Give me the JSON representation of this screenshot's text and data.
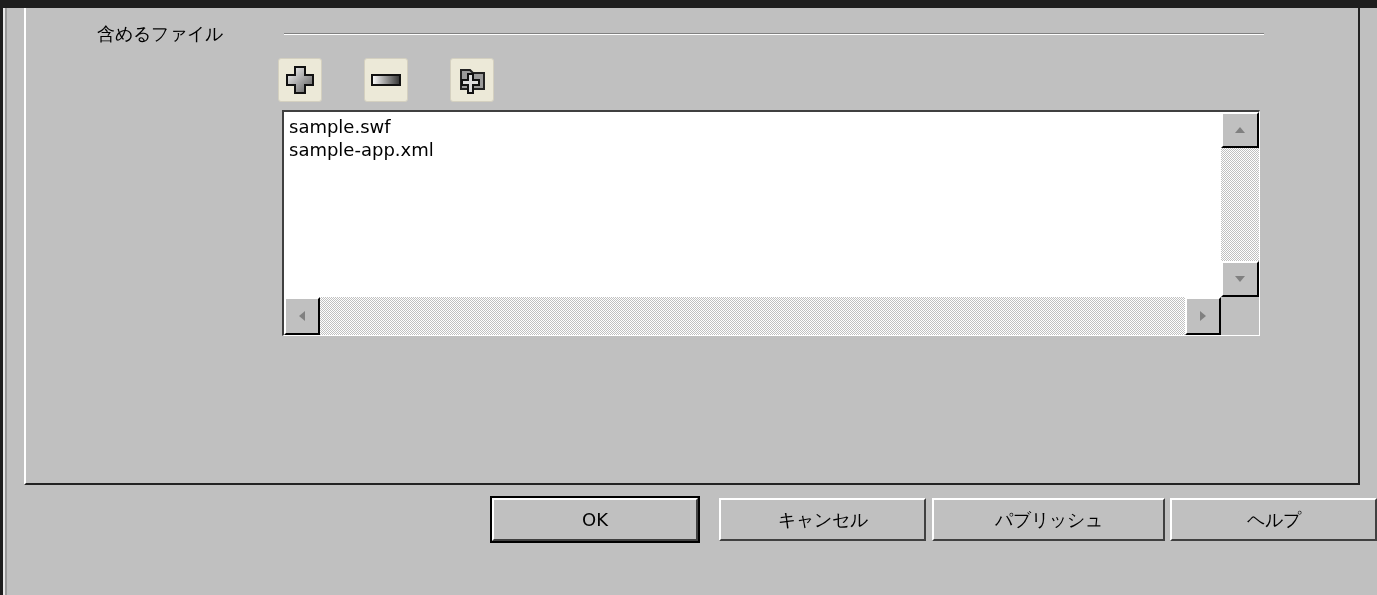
{
  "section": {
    "label": "含めるファイル"
  },
  "files": [
    {
      "name": "sample.swf",
      "selected": false
    },
    {
      "name": "sample-app.xml",
      "selected": false
    }
  ],
  "buttons": [
    {
      "label": "OK",
      "default": true
    },
    {
      "label": "キャンセル",
      "default": false
    },
    {
      "label": "パブリッシュ",
      "default": false
    },
    {
      "label": "ヘルプ",
      "default": false
    }
  ]
}
